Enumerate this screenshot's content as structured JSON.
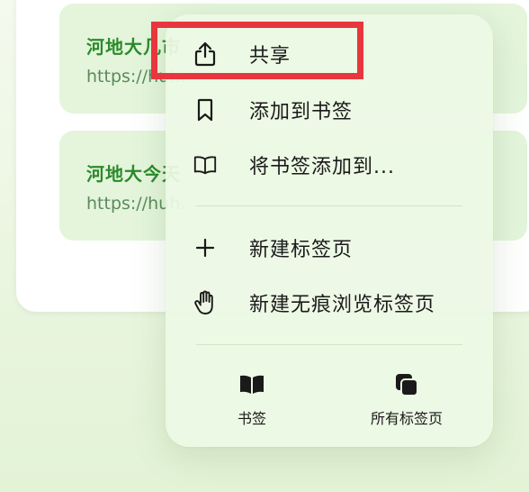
{
  "background_page": {
    "links": [
      {
        "title": "河地大几市",
        "url": "https://huh."
      },
      {
        "title": "河地大今天",
        "url": "https://huh."
      }
    ]
  },
  "menu": {
    "items": [
      {
        "label": "共享",
        "icon": "share-icon"
      },
      {
        "label": "添加到书签",
        "icon": "bookmark-icon"
      },
      {
        "label": "将书签添加到...",
        "icon": "open-book-icon"
      },
      {
        "label": "新建标签页",
        "icon": "plus-icon"
      },
      {
        "label": "新建无痕浏览标签页",
        "icon": "hand-icon"
      }
    ],
    "bottom": [
      {
        "label": "书签",
        "icon": "bookmarks-book-icon"
      },
      {
        "label": "所有标签页",
        "icon": "tabs-stack-icon"
      }
    ],
    "highlighted_item": "共享"
  },
  "colors": {
    "accent_highlight": "#e8363e",
    "link_title": "#2b8a2b",
    "menu_bg": "#ecf9e4"
  }
}
